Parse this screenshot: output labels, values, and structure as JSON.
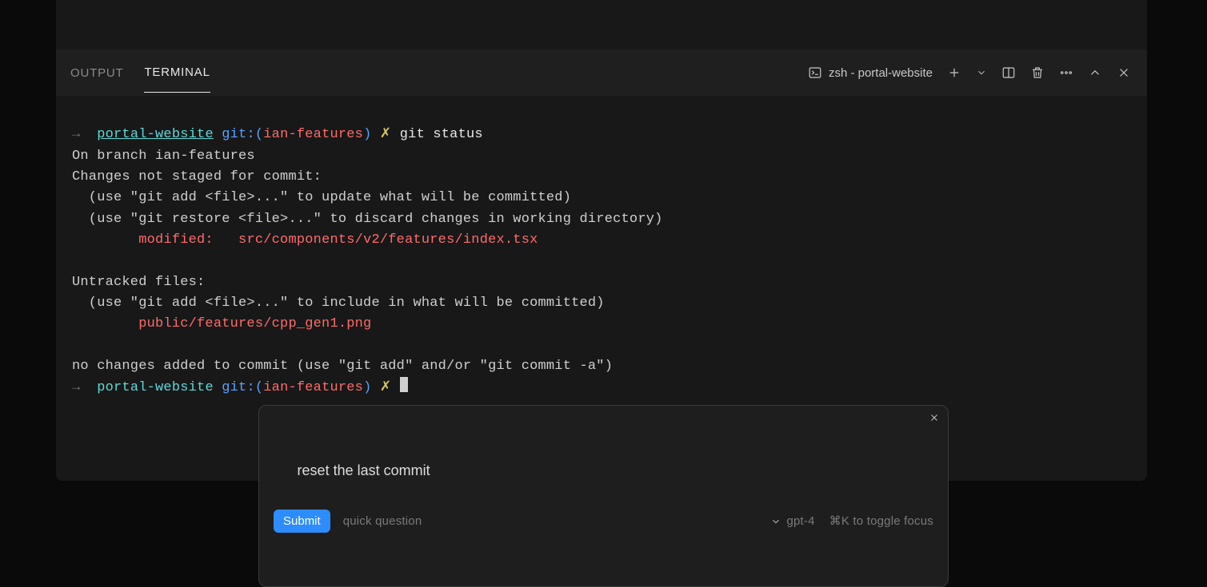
{
  "tabs": {
    "output": "OUTPUT",
    "terminal": "TERMINAL"
  },
  "shell": {
    "icon": "terminal",
    "label": "zsh - portal-website"
  },
  "term": {
    "arrow": "→",
    "project": "portal-website",
    "git_prefix": "git:(",
    "branch": "ian-features",
    "git_suffix": ")",
    "dirty": "✗",
    "cmd": "git status",
    "line_onbranch": "On branch ian-features",
    "line_notstaged": "Changes not staged for commit:",
    "line_useadd": "  (use \"git add <file>...\" to update what will be committed)",
    "line_userestore": "  (use \"git restore <file>...\" to discard changes in working directory)",
    "line_modified_label": "        modified:   ",
    "line_modified_file": "src/components/v2/features/index.tsx",
    "line_untracked": "Untracked files:",
    "line_useaddinc": "  (use \"git add <file>...\" to include in what will be committed)",
    "line_untracked_file": "        public/features/cpp_gen1.png",
    "line_nochanges": "no changes added to commit (use \"git add\" and/or \"git commit -a\")"
  },
  "popup": {
    "input": "reset the last commit",
    "submit": "Submit",
    "hint": "quick question",
    "model": "gpt-4",
    "shortcut": "⌘K to toggle focus"
  }
}
